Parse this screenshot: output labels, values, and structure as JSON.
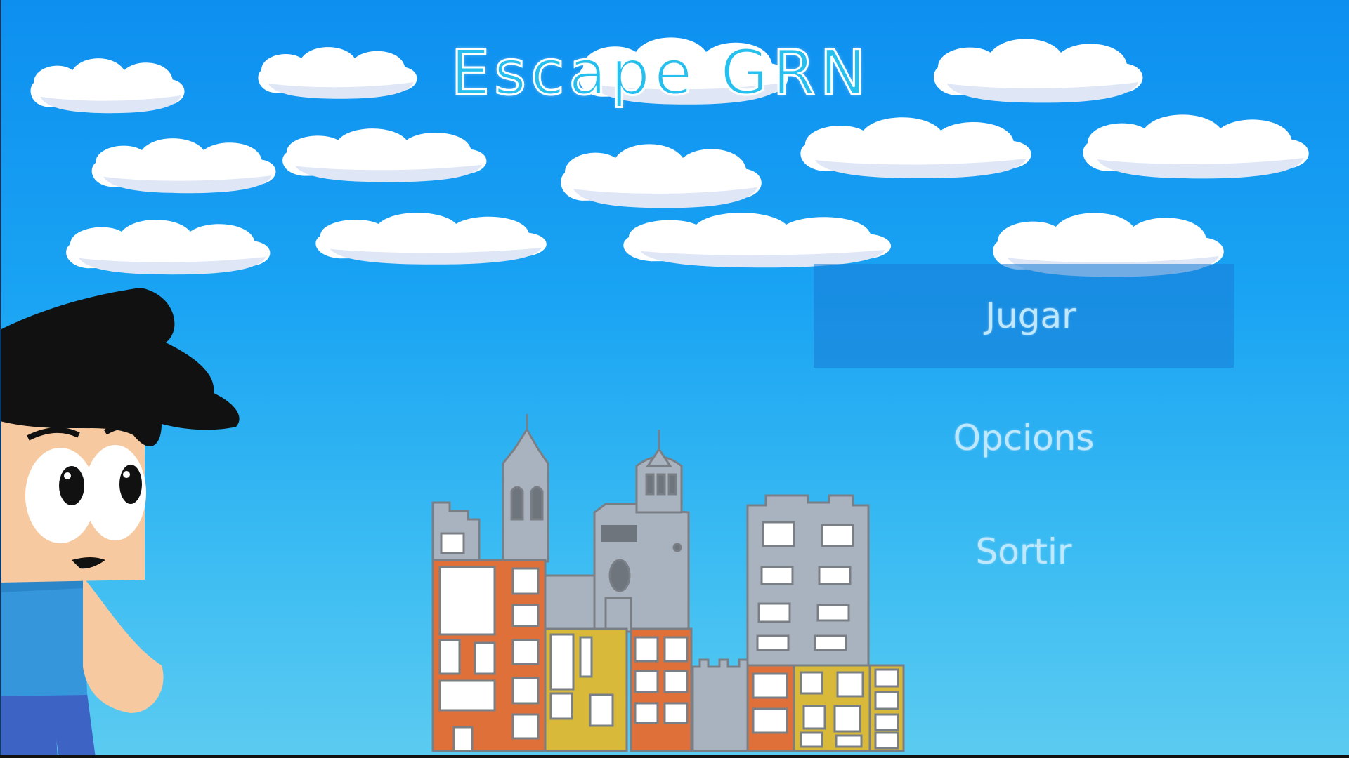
{
  "game": {
    "title": "Escape GRN"
  },
  "menu": {
    "play_label": "Jugar",
    "options_label": "Opcions",
    "exit_label": "Sortir",
    "selected": "Jugar"
  },
  "colors": {
    "sky_top": "#0d8ff0",
    "sky_bottom": "#5ccbf1",
    "title_fill": "#27c0ee",
    "title_outline": "#ffffff",
    "menu_text": "#bfe8ff",
    "menu_highlight": "#187cd6",
    "building_orange": "#e0703a",
    "building_yellow": "#d8b93a",
    "building_gray": "#a9b3bf"
  }
}
